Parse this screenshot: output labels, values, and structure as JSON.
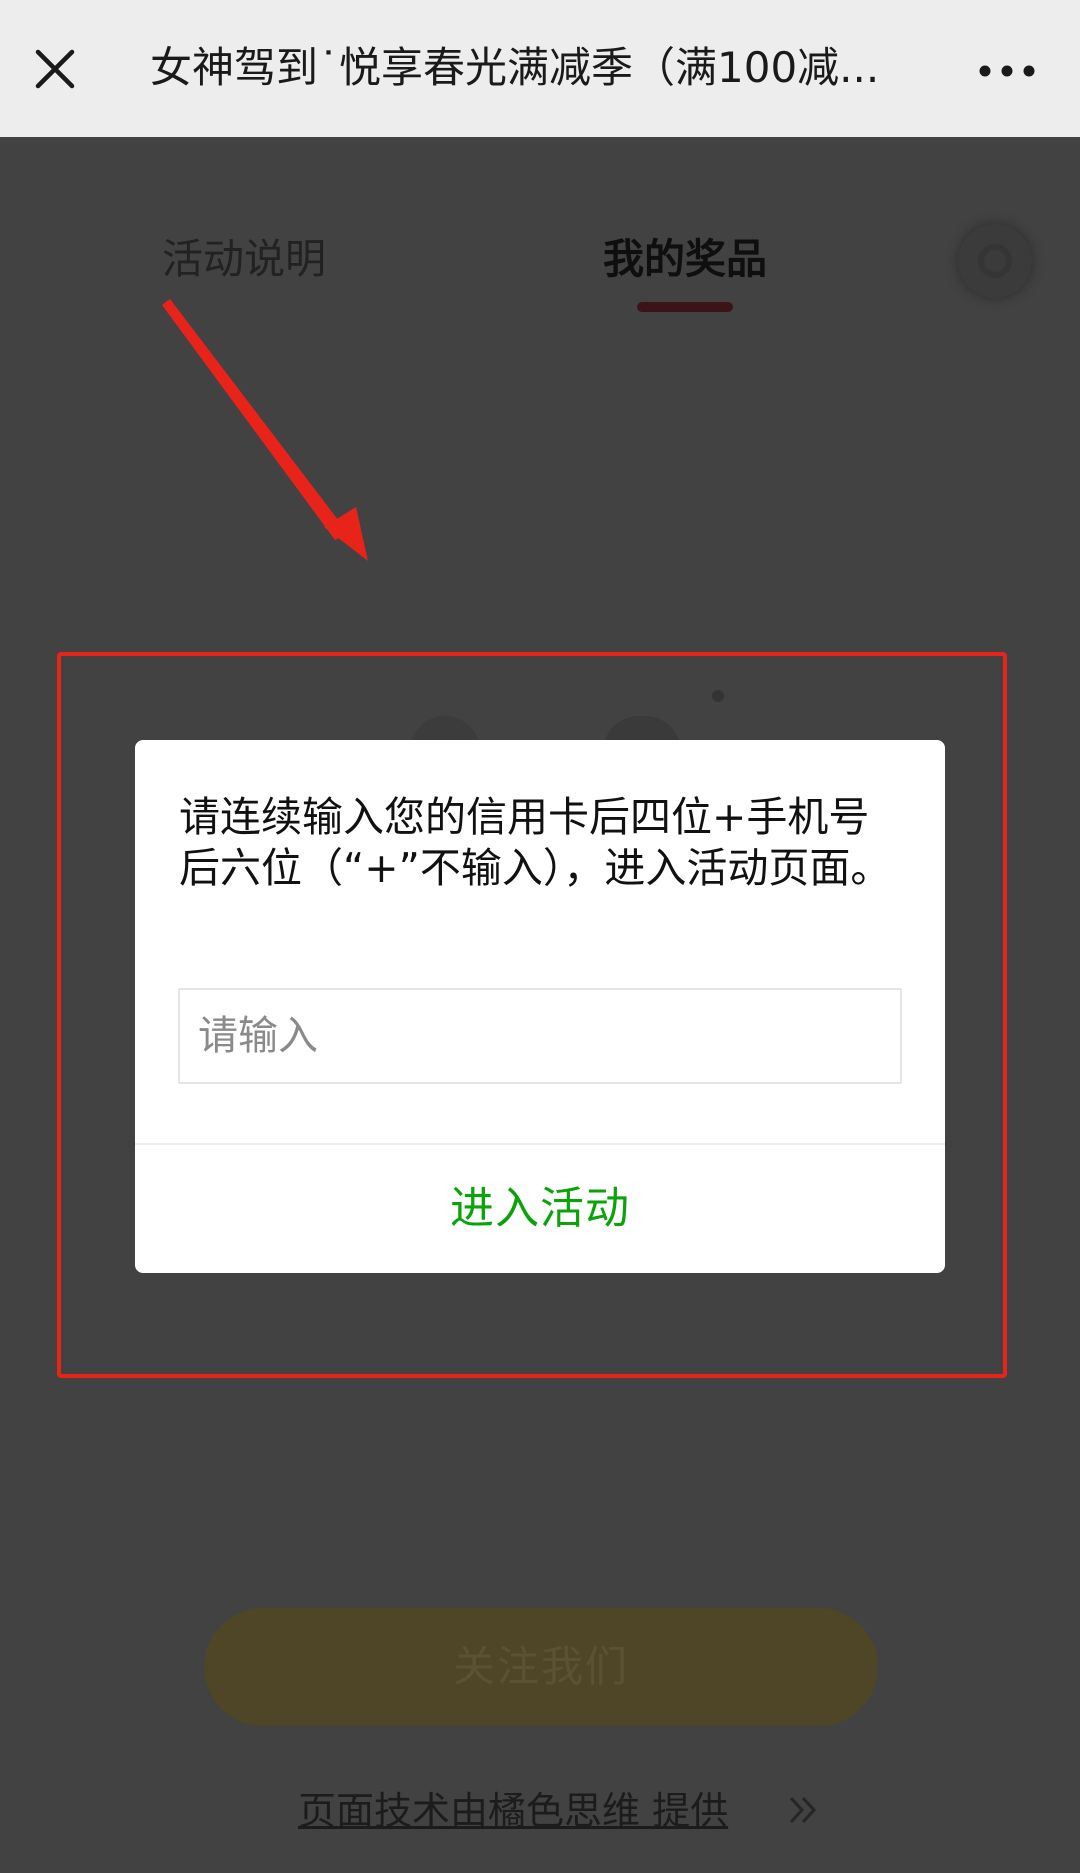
{
  "topbar": {
    "close_icon": "close-icon",
    "title": "女神驾到˙悦享春光满减季（满100减...",
    "more_icon": "more-dots-icon"
  },
  "tabs": [
    {
      "label": "活动说明",
      "active": false
    },
    {
      "label": "我的奖品",
      "active": true
    }
  ],
  "settings_icon": "gear-icon",
  "modal": {
    "message": "请连续输入您的信用卡后四位+手机号后六位（“+”不输入），进入活动页面。",
    "input_value": "",
    "input_placeholder": "请输入",
    "confirm_label": "进入活动",
    "confirm_color": "#0aa30a"
  },
  "follow_button_label": "关注我们",
  "footer": {
    "credit_text": "页面技术由橘色思维 提供",
    "arrow_icon": "double-chevron-right-icon"
  },
  "annotation": {
    "color": "#e8231a"
  }
}
